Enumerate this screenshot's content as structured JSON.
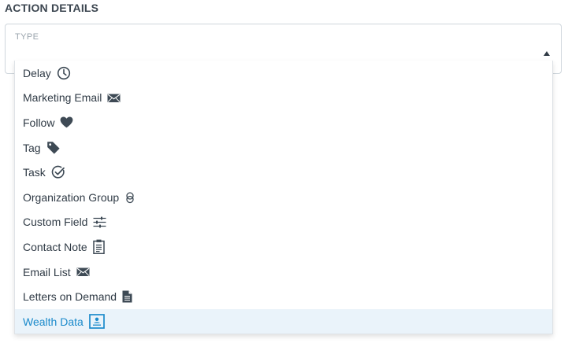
{
  "section": {
    "title": "ACTION DETAILS"
  },
  "type_field": {
    "label": "TYPE"
  },
  "colors": {
    "accent": "#1b8acb",
    "selected_bg": "#eaf3fa",
    "text": "#2f3a45",
    "border": "#cfd6dc"
  },
  "options": [
    {
      "label": "Delay",
      "icon": "clock-icon"
    },
    {
      "label": "Marketing Email",
      "icon": "envelope-icon"
    },
    {
      "label": "Follow",
      "icon": "heart-icon"
    },
    {
      "label": "Tag",
      "icon": "tag-icon"
    },
    {
      "label": "Task",
      "icon": "check-circle-icon"
    },
    {
      "label": "Organization Group",
      "icon": "linked-circles-icon"
    },
    {
      "label": "Custom Field",
      "icon": "sliders-icon"
    },
    {
      "label": "Contact Note",
      "icon": "clipboard-icon"
    },
    {
      "label": "Email List",
      "icon": "envelope-icon"
    },
    {
      "label": "Letters on Demand",
      "icon": "document-icon"
    },
    {
      "label": "Wealth Data",
      "icon": "contact-card-icon",
      "selected": true
    }
  ]
}
